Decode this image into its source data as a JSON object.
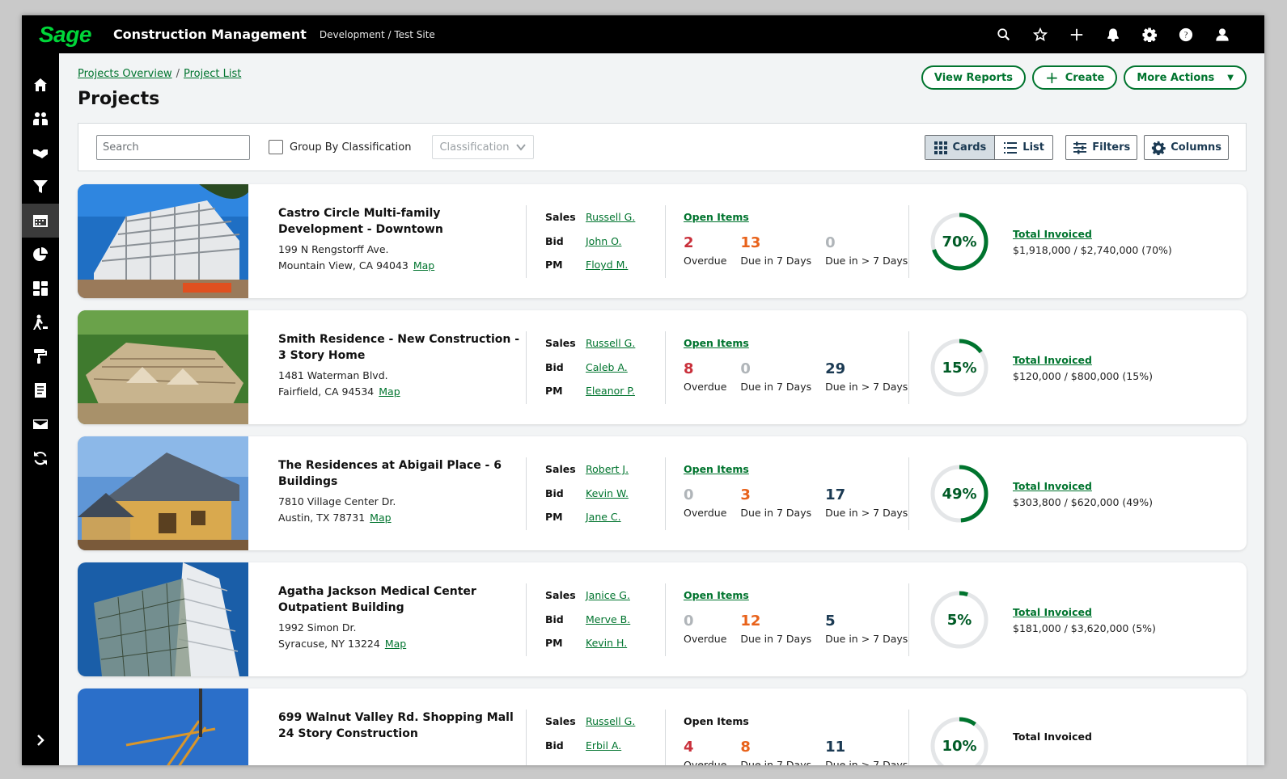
{
  "app": {
    "logo": "Sage",
    "title": "Construction Management",
    "site": "Development / Test Site"
  },
  "topbar_icons": [
    "search-icon",
    "star-icon",
    "plus-icon",
    "bell-icon",
    "gear-icon",
    "help-icon",
    "user-icon"
  ],
  "sidebar_icons": [
    "home-icon",
    "team-icon",
    "handshake-icon",
    "funnel-icon",
    "calendar-icon",
    "pie-chart-icon",
    "dashboard-icon",
    "worker-icon",
    "paint-roller-icon",
    "document-icon",
    "mail-icon",
    "sync-icon"
  ],
  "sidebar_active": "calendar-icon",
  "breadcrumb": {
    "item1": "Projects Overview",
    "sep": "/",
    "item2": "Project List"
  },
  "page_title": "Projects",
  "actions": {
    "view_reports": "View Reports",
    "create": "Create",
    "more_actions": "More Actions"
  },
  "toolbar": {
    "search_placeholder": "Search",
    "group_by": "Group By Classification",
    "classification": "Classification",
    "cards": "Cards",
    "list": "List",
    "filters": "Filters",
    "columns": "Columns"
  },
  "labels": {
    "sales": "Sales",
    "bid": "Bid",
    "pm": "PM",
    "open_items": "Open Items",
    "overdue": "Overdue",
    "due7": "Due in 7 Days",
    "due_gt7": "Due in > 7 Days",
    "total_invoiced": "Total Invoiced",
    "map": "Map"
  },
  "colors": {
    "brand_green": "#00742e",
    "overdue_red": "#c9303b",
    "due_orange": "#e8621a",
    "navy": "#1b3a53",
    "zero_gray": "#b0b5b9"
  },
  "projects": [
    {
      "title": "Castro Circle Multi-family Development - Downtown",
      "addr1": "199 N Rengstorff Ave.",
      "addr2": "Mountain View, CA 94043",
      "sales": "Russell G.",
      "bid": "John O.",
      "pm": "Floyd M.",
      "overdue": "2",
      "due7": "13",
      "due_gt7": "0",
      "percent": "70%",
      "progress": 0.7,
      "invoiced": "$1,918,000 / $2,740,000 (70%)",
      "image": "building-frame"
    },
    {
      "title": "Smith Residence - New Construction - 3 Story Home",
      "addr1": "1481 Waterman Blvd.",
      "addr2": "Fairfield, CA 94534",
      "sales": "Russell G.",
      "bid": "Caleb A.",
      "pm": "Eleanor P.",
      "overdue": "8",
      "due7": "0",
      "due_gt7": "29",
      "percent": "15%",
      "progress": 0.15,
      "invoiced": "$120,000 / $800,000 (15%)",
      "image": "house-roof"
    },
    {
      "title": "The Residences at Abigail Place - 6 Buildings",
      "addr1": "7810 Village Center Dr.",
      "addr2": "Austin, TX 78731",
      "sales": "Robert J.",
      "bid": "Kevin W.",
      "pm": "Jane C.",
      "overdue": "0",
      "due7": "3",
      "due_gt7": "17",
      "percent": "49%",
      "progress": 0.49,
      "invoiced": "$303,800 / $620,000 (49%)",
      "image": "wood-house"
    },
    {
      "title": "Agatha Jackson Medical Center Outpatient Building",
      "addr1": "1992 Simon Dr.",
      "addr2": "Syracuse, NY 13224",
      "sales": "Janice G.",
      "bid": "Merve B.",
      "pm": "Kevin H.",
      "overdue": "0",
      "due7": "12",
      "due_gt7": "5",
      "percent": "5%",
      "progress": 0.05,
      "invoiced": "$181,000 / $3,620,000 (5%)",
      "image": "tower"
    },
    {
      "title": "699 Walnut Valley Rd. Shopping Mall 24 Story Construction",
      "addr1": "",
      "addr2": "",
      "sales": "Russell G.",
      "bid": "Erbil A.",
      "pm": "",
      "overdue": "4",
      "due7": "8",
      "due_gt7": "11",
      "percent": "10%",
      "progress": 0.1,
      "invoiced": "",
      "image": "crane"
    }
  ]
}
